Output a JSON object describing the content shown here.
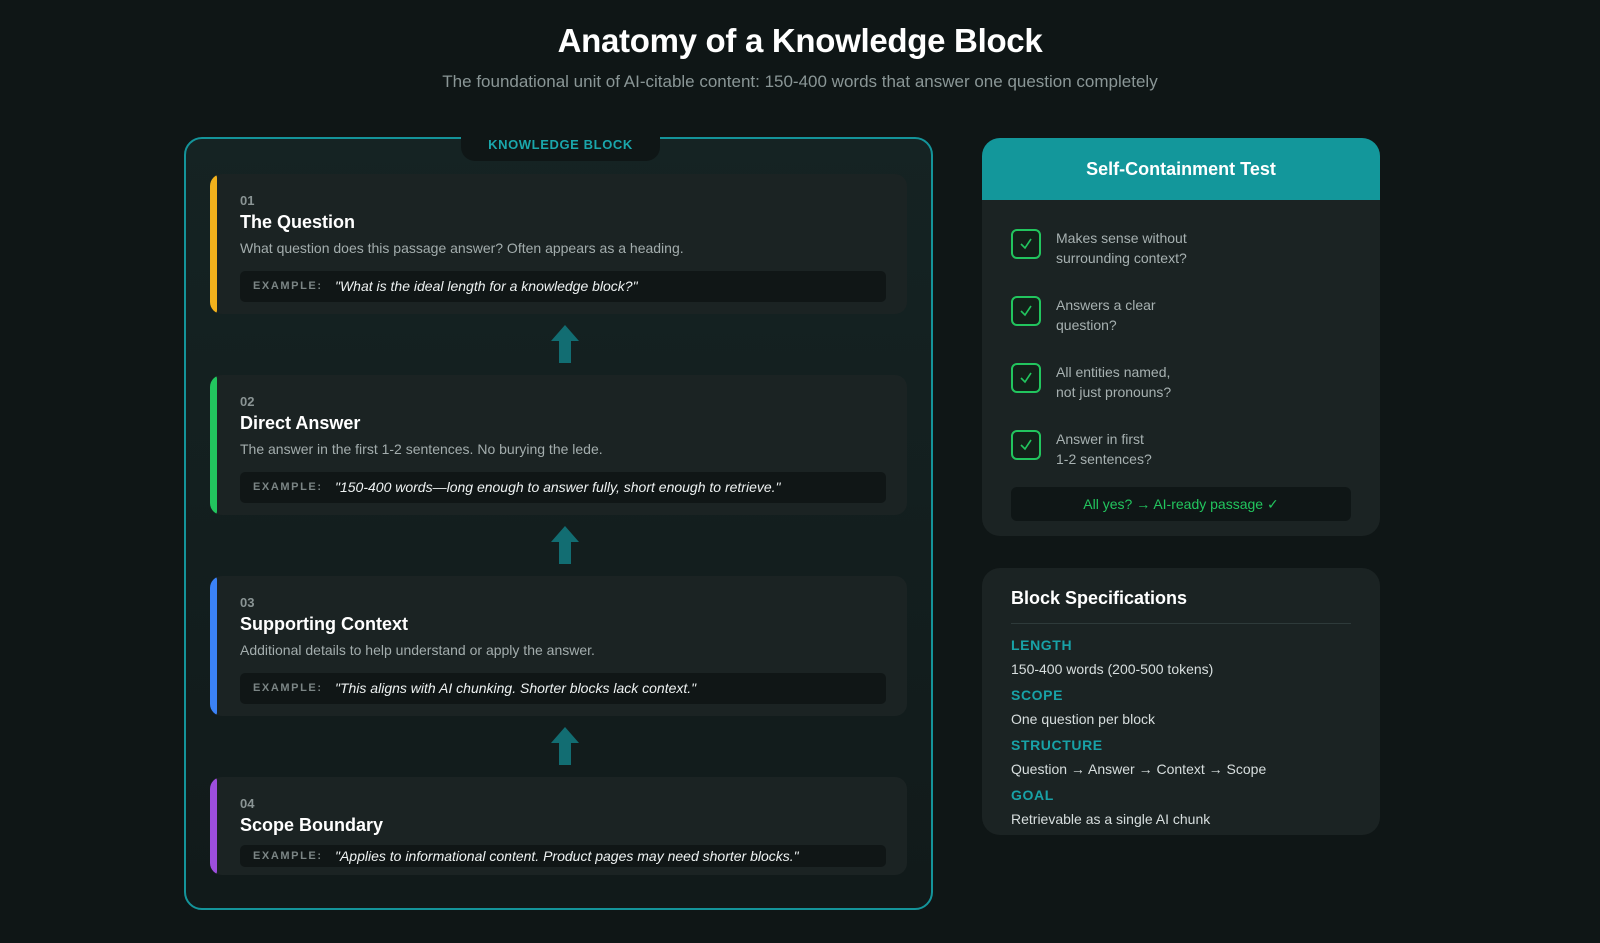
{
  "header": {
    "title": "Anatomy of a Knowledge Block",
    "subtitle": "The foundational unit of AI-citable content: 150-400 words that answer one question completely"
  },
  "knowledge_block": {
    "label": "KNOWLEDGE BLOCK",
    "example_label": "EXAMPLE:",
    "arrow_color": "#126d72",
    "sections": [
      {
        "number": "01",
        "title": "The Question",
        "description": "What question does this passage answer? Often appears as a heading.",
        "example": "\"What is the ideal length for a knowledge block?\"",
        "accent": "#f2b11c"
      },
      {
        "number": "02",
        "title": "Direct Answer",
        "description": "The answer in the first 1-2 sentences. No burying the lede.",
        "example": "\"150-400 words—long enough to answer fully, short enough to retrieve.\"",
        "accent": "#22c55e"
      },
      {
        "number": "03",
        "title": "Supporting Context",
        "description": "Additional details to help understand or apply the answer.",
        "example": "\"This aligns with AI chunking. Shorter blocks lack context.\"",
        "accent": "#3b82f6"
      },
      {
        "number": "04",
        "title": "Scope Boundary",
        "description": "",
        "example": "\"Applies to informational content. Product pages may need shorter blocks.\"",
        "accent": "#9d4edd"
      }
    ]
  },
  "self_containment": {
    "title": "Self-Containment Test",
    "check_icon": "check-icon",
    "checks": [
      {
        "line1": "Makes sense without",
        "line2": "surrounding context?"
      },
      {
        "line1": "Answers a clear",
        "line2": "question?"
      },
      {
        "line1": "All entities named,",
        "line2": "not just pronouns?"
      },
      {
        "line1": "Answer in first",
        "line2": "1-2 sentences?"
      }
    ],
    "footer": "All yes? → AI-ready passage ✓",
    "accent": "#13979b",
    "success_color": "#22c55e"
  },
  "specifications": {
    "title": "Block Specifications",
    "items": [
      {
        "label": "LENGTH",
        "value": "150-400 words (200-500 tokens)"
      },
      {
        "label": "SCOPE",
        "value": "One question per block"
      },
      {
        "label": "STRUCTURE",
        "value": "Question → Answer → Context → Scope"
      },
      {
        "label": "GOAL",
        "value": "Retrievable as a single AI chunk"
      }
    ]
  }
}
